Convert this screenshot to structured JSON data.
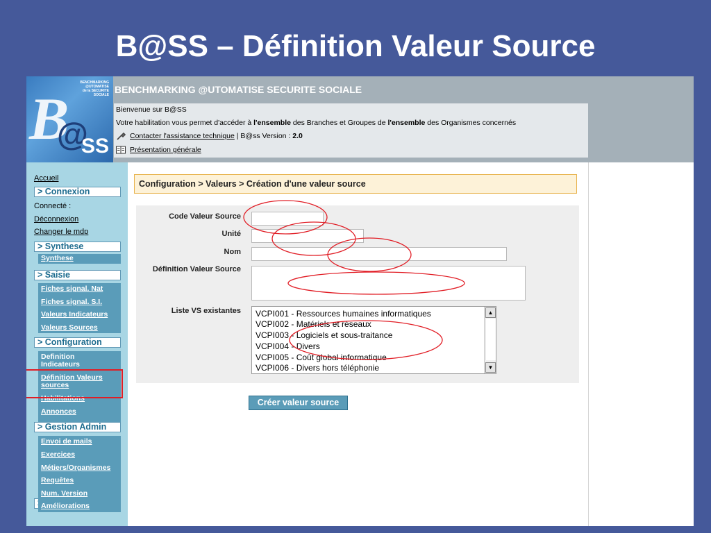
{
  "slide": {
    "title": "B@SS – Définition Valeur Source"
  },
  "logo": {
    "text_lines": [
      "BENCHMARKING",
      "@UTOMATISE",
      "de la SECURITE",
      "SOCIALE"
    ],
    "letter_b": "B",
    "letter_at": "@",
    "letters_ss": "SS"
  },
  "header": {
    "title": "BENCHMARKING @UTOMATISE SECURITE SOCIALE",
    "welcome": "Bienvenue sur B@SS",
    "habilitation_prefix": "Votre habilitation vous permet d'accéder à ",
    "habilitation_bold1": "l'ensemble",
    "habilitation_mid": " des Branches et Groupes de ",
    "habilitation_bold2": "l'ensemble",
    "habilitation_suffix": " des Organismes concernés",
    "contact_link": "Contacter l'assistance technique",
    "version_text": " | B@ss Version : ",
    "version_value": "2.0",
    "presentation_link": "Présentation générale",
    "icons": [
      "wrench-icon",
      "book-icon"
    ]
  },
  "sidebar": {
    "accueil": "Accueil",
    "connexion_head": "> Connexion",
    "connecte": "Connecté :",
    "deconnexion": "Déconnexion",
    "changer_mdp": "Changer le mdp",
    "synthese_head": "> Synthese",
    "synthese_items": [
      "Synthese"
    ],
    "saisie_head": "> Saisie",
    "saisie_items": [
      "Fiches signal. Nat",
      "Fiches signal. S.I.",
      "Valeurs Indicateurs",
      "Valeurs Sources"
    ],
    "configuration_head": "> Configuration",
    "configuration_items": [
      "Definition",
      "Indicateurs",
      "Définition Valeurs",
      "sources",
      "Habilitations",
      "Annonces"
    ],
    "gestion_head": "> Gestion Admin",
    "gestion_items": [
      "Envoi de mails",
      "Exercices",
      "Métiers/Organismes",
      "Requêtes",
      "Num. Version",
      "Améliorations"
    ]
  },
  "main": {
    "breadcrumb": "Configuration > Valeurs > Création d'une valeur source",
    "labels": {
      "code": "Code Valeur Source",
      "unite": "Unité",
      "nom": "Nom",
      "definition": "Définition Valeur Source",
      "liste": "Liste VS existantes"
    },
    "values": {
      "code": "",
      "unite": "",
      "nom": "",
      "definition": ""
    },
    "list_items": [
      "VCPI001 - Ressources humaines informatiques",
      "VCPI002 - Matériels et réseaux",
      "VCPI003 - Logiciels et sous-traitance",
      "VCPI004 - Divers",
      "VCPI005 - Coût global informatique",
      "VCPI006 - Divers hors téléphonie"
    ],
    "create_button": "Créer valeur source"
  },
  "colors": {
    "slide_bg": "#45599a",
    "header_bg": "#a4b0b8",
    "sidebar_bg": "#a8d6e4",
    "sidebar_box": "#5a9cb9",
    "breadcrumb_bg": "#fdf2d8",
    "annotation_red": "#e11d25"
  }
}
